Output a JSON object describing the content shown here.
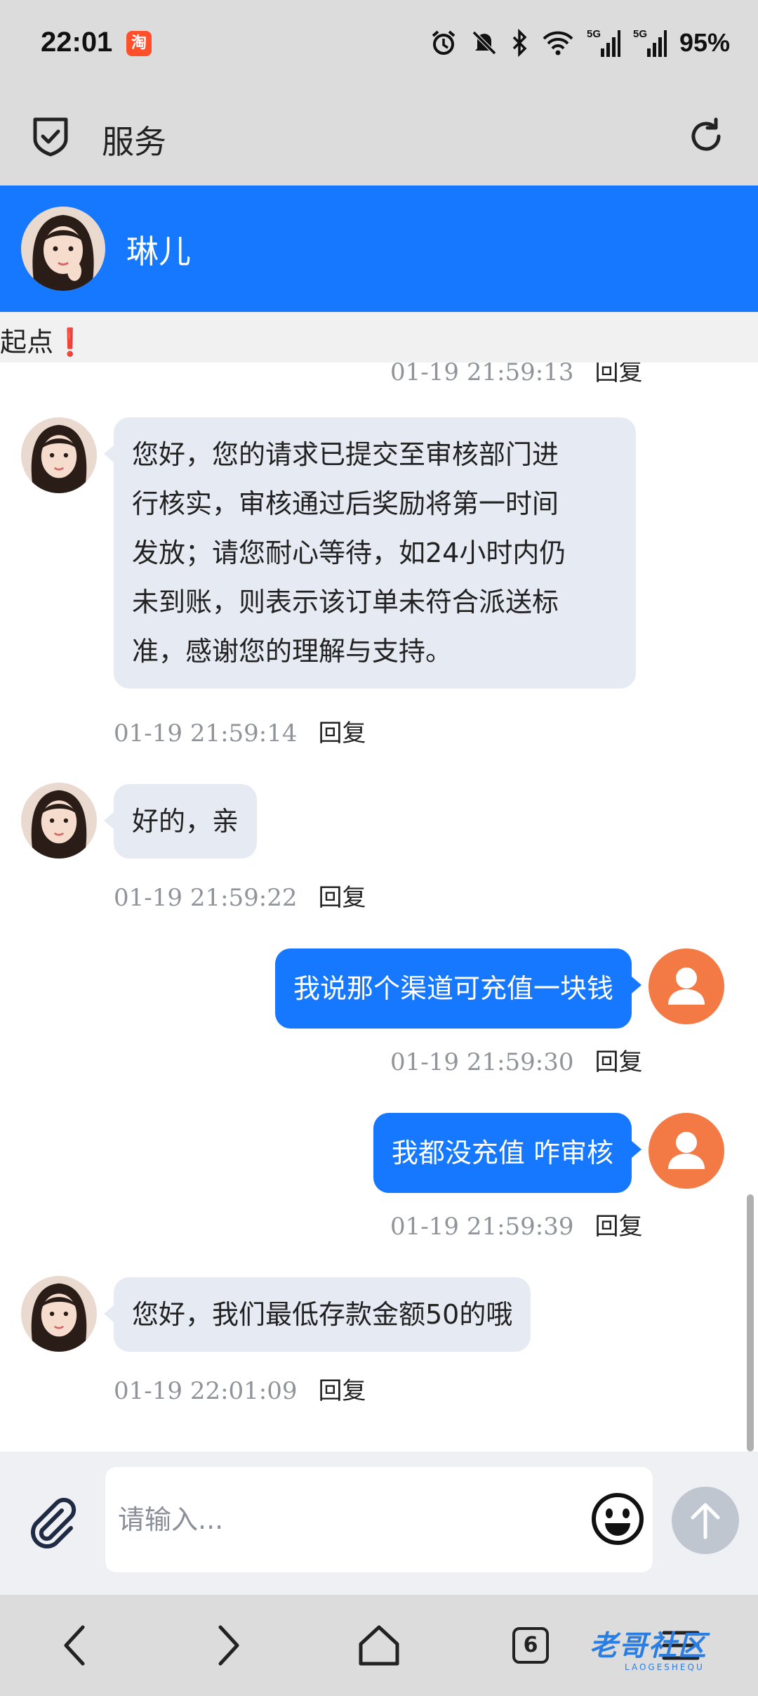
{
  "status_bar": {
    "time": "22:01",
    "app_badge": "淘",
    "battery": "95%",
    "icons": [
      "alarm-icon",
      "mute-icon",
      "bluetooth-icon",
      "wifi-icon",
      "signal-5g-icon",
      "signal-5g-icon"
    ]
  },
  "browser": {
    "title": "服务",
    "icons": [
      "shield-check-icon",
      "refresh-icon"
    ]
  },
  "chat": {
    "agent_name": "琳儿",
    "notice_text": "起点",
    "notice_mark": "❗",
    "reply_label": "回复",
    "messages": [
      {
        "from": "user",
        "text": "",
        "time": "01-19 21:59:13"
      },
      {
        "from": "agent",
        "text": "您好，您的请求已提交至审核部门进\n行核实，审核通过后奖励将第一时间\n发放；请您耐心等待，如24小时内仍\n未到账，则表示该订单未符合派送标\n准，感谢您的理解与支持。",
        "time": "01-19 21:59:14"
      },
      {
        "from": "agent",
        "text": "好的，亲",
        "time": "01-19 21:59:22"
      },
      {
        "from": "user",
        "text": "我说那个渠道可充值一块钱",
        "time": "01-19 21:59:30"
      },
      {
        "from": "user",
        "text": "我都没充值 咋审核",
        "time": "01-19 21:59:39"
      },
      {
        "from": "agent",
        "text": "您好，我们最低存款金额50的哦",
        "time": "01-19 22:01:09"
      }
    ]
  },
  "composer": {
    "placeholder": "请输入..."
  },
  "nav": {
    "tab_count": "6",
    "watermark": "老哥社区",
    "watermark_sub": "LAOGESHEQU"
  },
  "colors": {
    "accent": "#1677ff",
    "agent_bubble": "#e6ebf3",
    "user_avatar": "#f47a45",
    "chrome": "#dcdcdc"
  }
}
